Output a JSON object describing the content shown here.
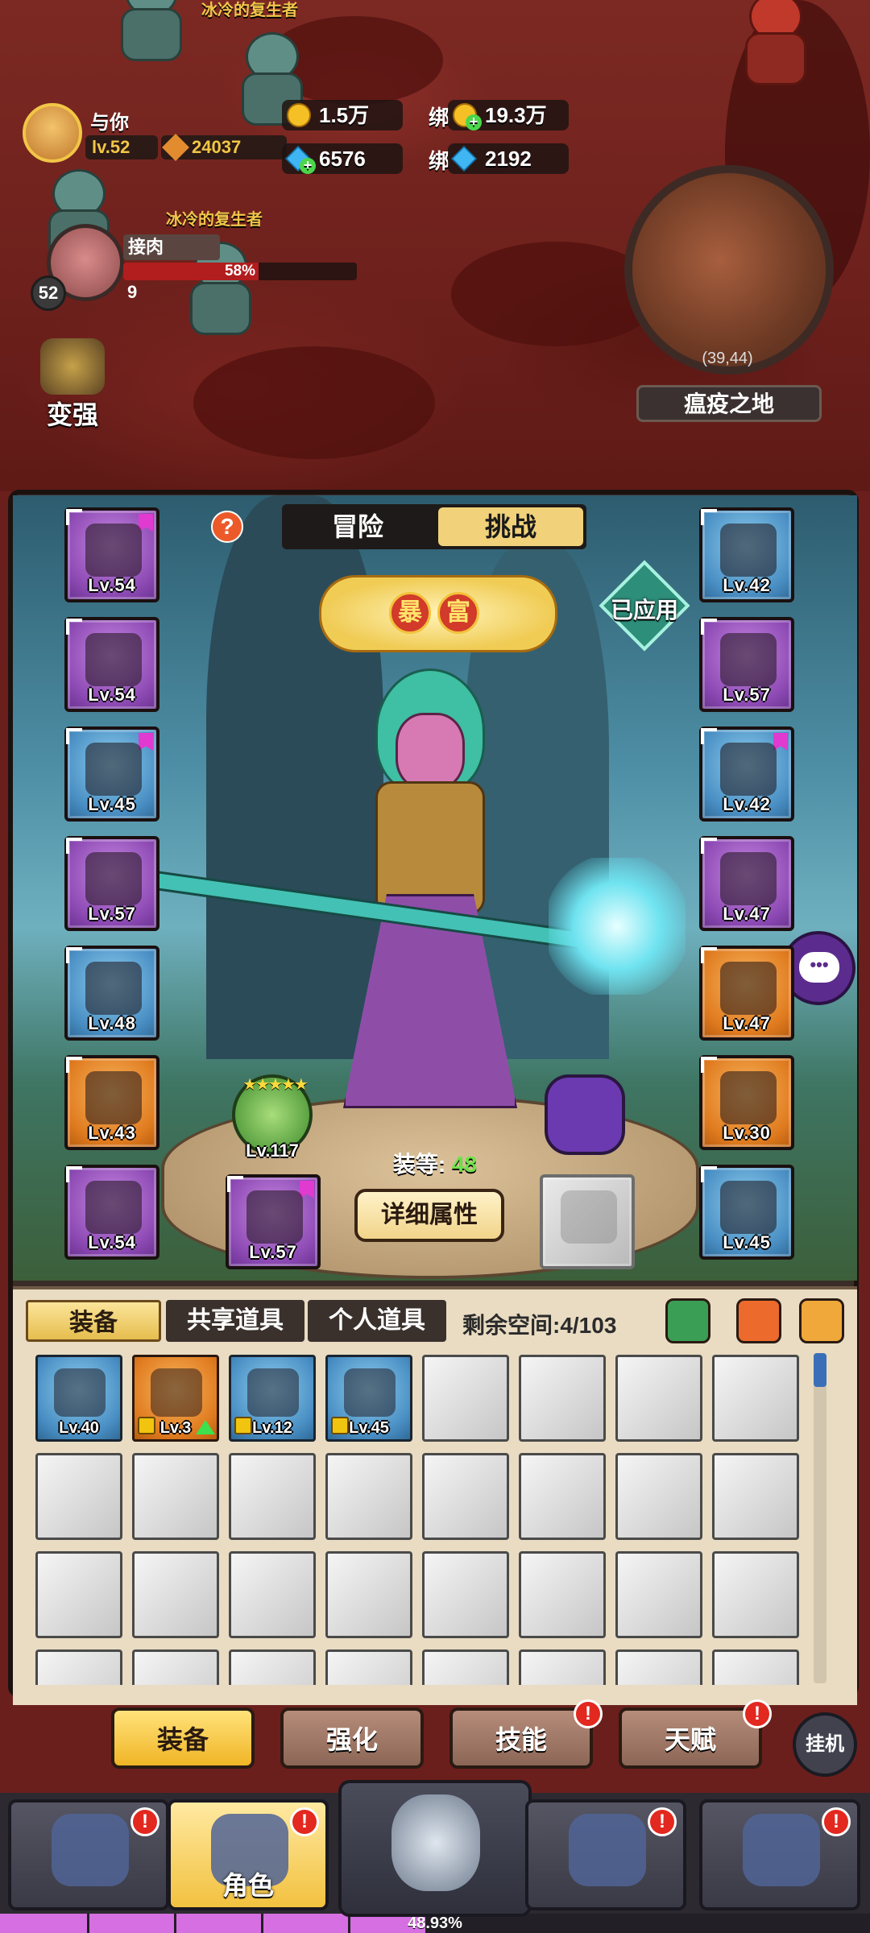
{
  "world": {
    "mob_name_top": "冰冷的复生者",
    "mob_name_mid": "冰冷的复生者",
    "player": {
      "name": "与你",
      "level": "lv.52",
      "power": "24037"
    },
    "currency": {
      "gold": "1.5万",
      "bound_gold_tag": "绑",
      "bound_gold": "19.3万",
      "diamond": "6576",
      "bound_diamond_tag": "绑",
      "bound_diamond": "2192"
    },
    "target": {
      "name": "接肉",
      "hp_percent": 58,
      "hp_text": "58%",
      "level": "52",
      "count": "9"
    },
    "strengthen_label": "变强",
    "minimap": {
      "coords": "(39,44)",
      "zone": "瘟疫之地"
    }
  },
  "panel": {
    "mode_tabs": {
      "adventure": "冒险",
      "challenge": "挑战",
      "active": "challenge"
    },
    "help": "?",
    "rich_badge": [
      "暴",
      "富"
    ],
    "applied": "已应用",
    "left_slots": [
      {
        "label": "Lv.54",
        "rarity": "purple",
        "flag": true
      },
      {
        "label": "Lv.54",
        "rarity": "purple",
        "flag": false
      },
      {
        "label": "Lv.45",
        "rarity": "blue",
        "flag": true
      },
      {
        "label": "Lv.57",
        "rarity": "purple",
        "flag": false
      },
      {
        "label": "Lv.48",
        "rarity": "blue",
        "flag": false
      },
      {
        "label": "Lv.43",
        "rarity": "orange",
        "flag": false
      },
      {
        "label": "Lv.54",
        "rarity": "purple",
        "flag": false
      }
    ],
    "right_slots": [
      {
        "label": "Lv.42",
        "rarity": "blue",
        "flag": false
      },
      {
        "label": "Lv.57",
        "rarity": "purple",
        "flag": false
      },
      {
        "label": "Lv.42",
        "rarity": "blue",
        "flag": true
      },
      {
        "label": "Lv.47",
        "rarity": "purple",
        "flag": false
      },
      {
        "label": "Lv.47",
        "rarity": "orange",
        "flag": false
      },
      {
        "label": "Lv.30",
        "rarity": "orange",
        "flag": false
      },
      {
        "label": "Lv.45",
        "rarity": "blue",
        "flag": false
      }
    ],
    "weapon_slot": {
      "label": "Lv.57",
      "rarity": "purple"
    },
    "armor": {
      "stars": "★★★★★",
      "level": "Lv.117"
    },
    "equip_level_label": "装等:",
    "equip_level_value": "48",
    "detail_button": "详细属性"
  },
  "inventory": {
    "tabs": [
      "装备",
      "共享道具",
      "个人道具"
    ],
    "active_tab": 0,
    "space_label": "剩余空间:",
    "space_value": "4/103",
    "items": [
      {
        "label": "Lv.40",
        "rarity": "blue",
        "locked": false,
        "upgrade": false
      },
      {
        "label": "Lv.3",
        "rarity": "orange",
        "locked": true,
        "upgrade": true
      },
      {
        "label": "Lv.12",
        "rarity": "blue",
        "locked": true,
        "upgrade": false
      },
      {
        "label": "Lv.45",
        "rarity": "blue",
        "locked": true,
        "upgrade": false
      }
    ],
    "total_visible_cells": 32
  },
  "bottom_tabs": [
    {
      "label": "装备",
      "active": true,
      "badge": ""
    },
    {
      "label": "强化",
      "active": false,
      "badge": ""
    },
    {
      "label": "技能",
      "active": false,
      "badge": "!"
    },
    {
      "label": "天赋",
      "active": false,
      "badge": "!"
    }
  ],
  "auto_button": "挂机",
  "nav": {
    "items": [
      {
        "label": "",
        "badge": "!"
      },
      {
        "label": "角色",
        "badge": "!",
        "active": true
      },
      {
        "label": "",
        "badge": "",
        "center": true
      },
      {
        "label": "",
        "badge": "!"
      },
      {
        "label": "",
        "badge": "!"
      }
    ]
  },
  "exp": {
    "percent": 48.93,
    "text": "48.93%"
  },
  "colors": {
    "accent": "#f1d27a",
    "purple_rarity": "#8d4ab4",
    "blue_rarity": "#4a8fc4",
    "orange_rarity": "#e07b1f",
    "hp": "#b21d1d",
    "exp": "#d66fe2"
  }
}
